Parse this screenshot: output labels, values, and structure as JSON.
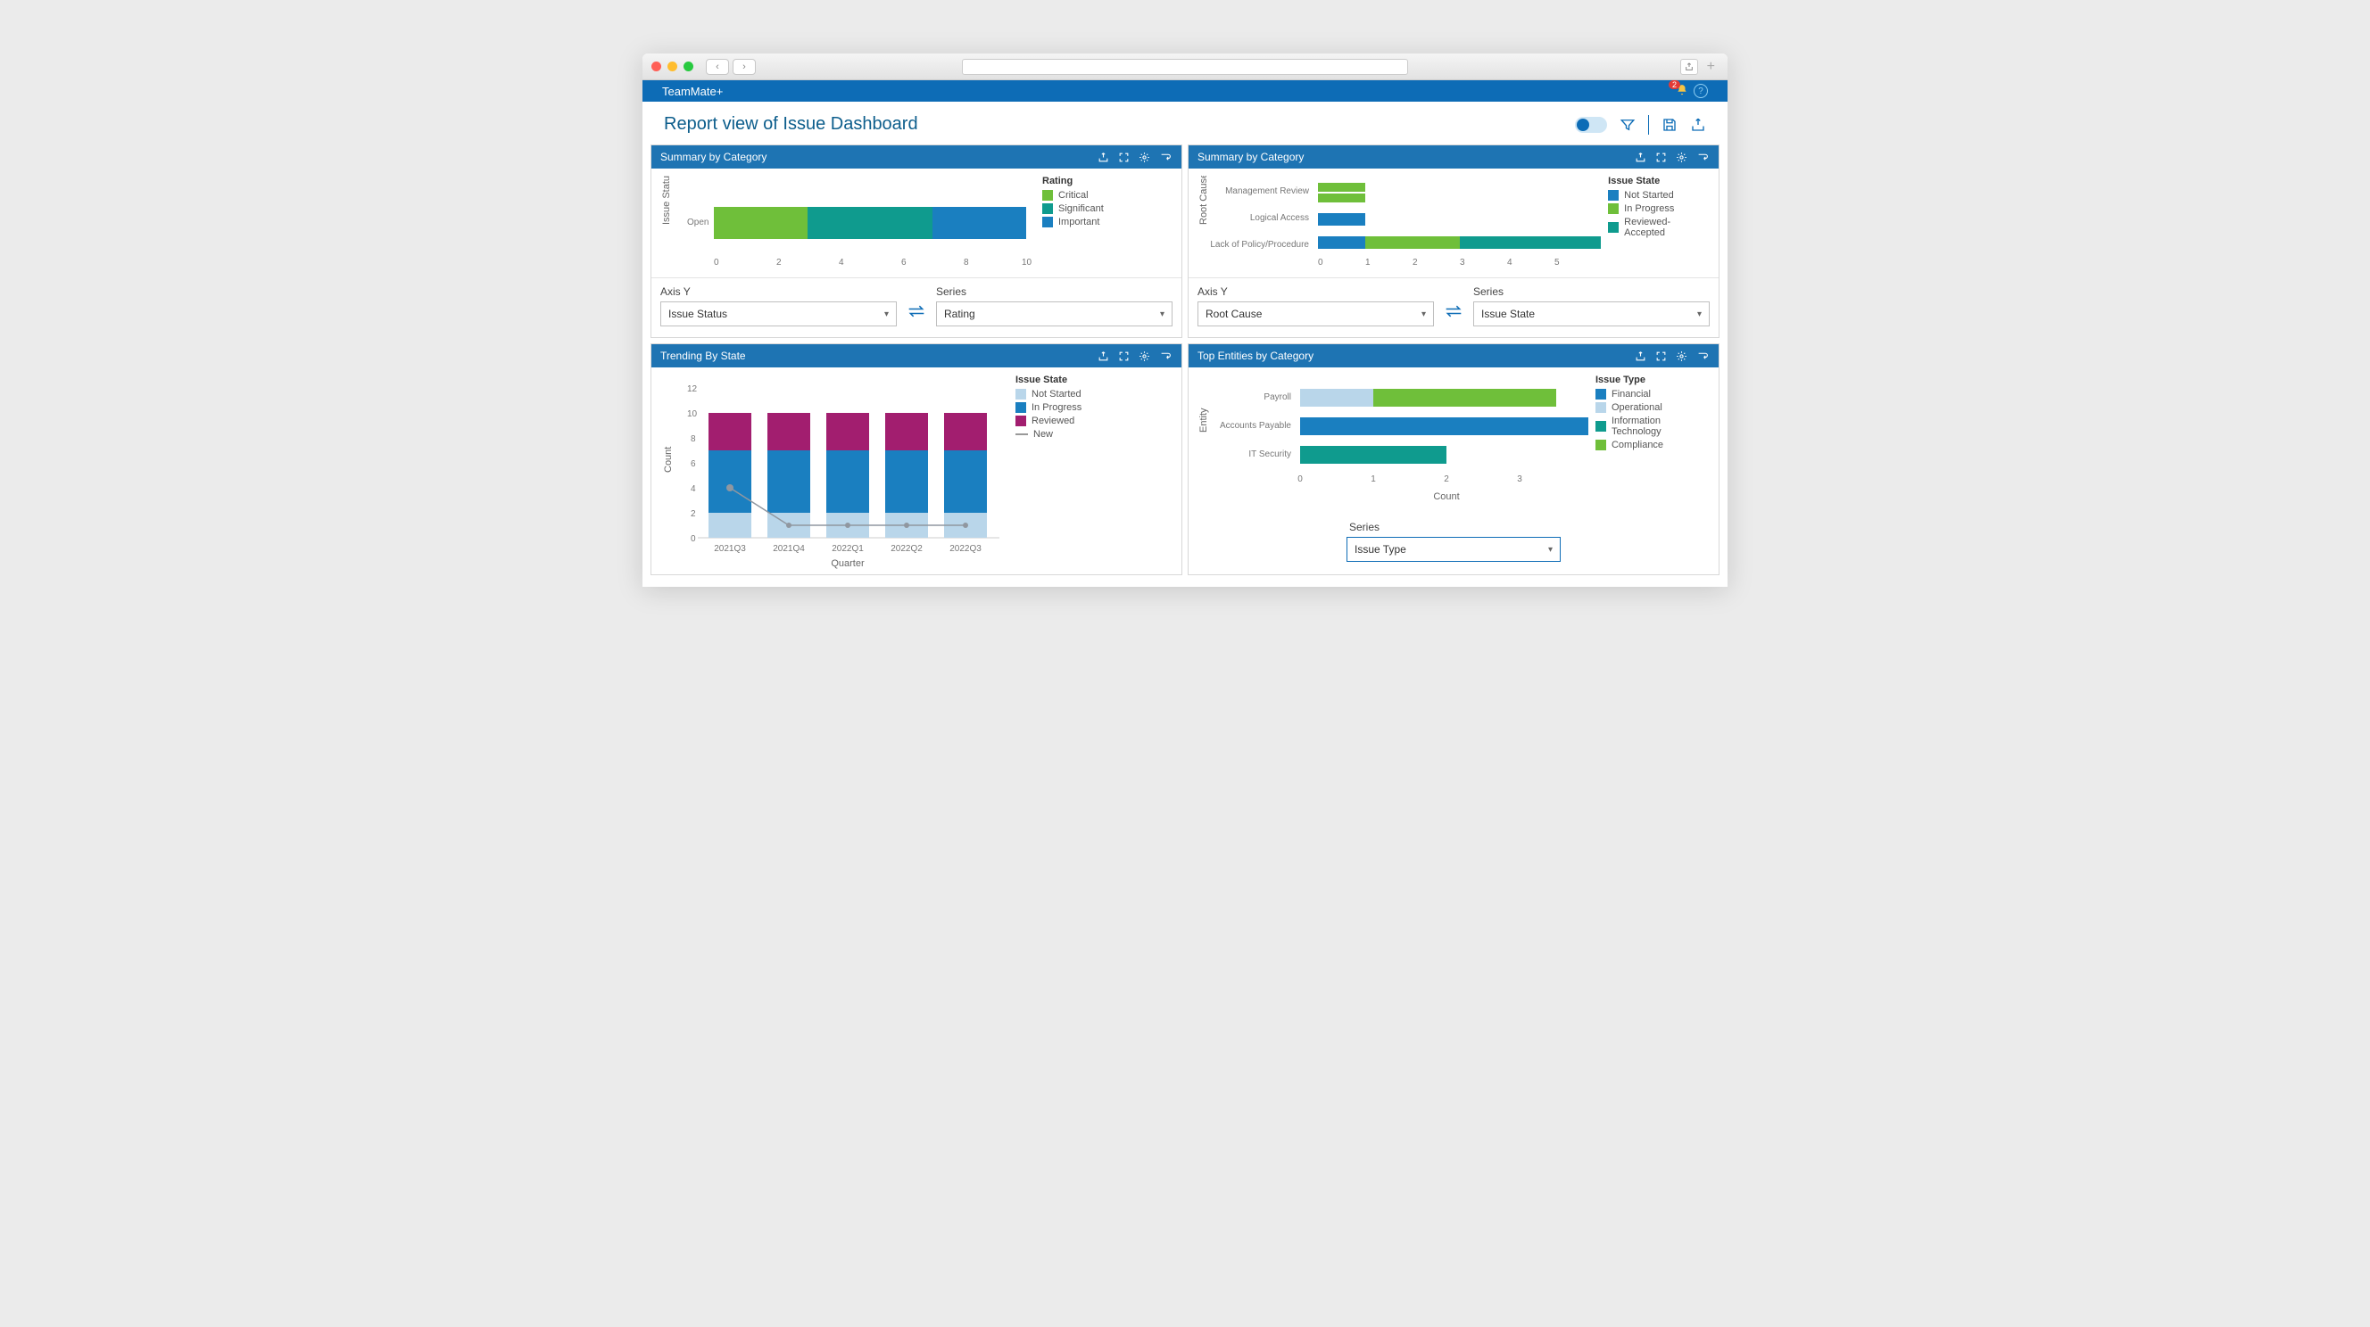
{
  "app": {
    "name": "TeamMate+",
    "notif_count": "2"
  },
  "page": {
    "title": "Report view of Issue Dashboard"
  },
  "panels": {
    "p1": {
      "title": "Summary by Category",
      "legend_title": "Rating",
      "legend": [
        "Critical",
        "Significant",
        "Important"
      ],
      "axisY_label": "Axis Y",
      "axisY_value": "Issue Status",
      "series_label": "Series",
      "series_value": "Rating",
      "y_axis_title": "Issue Status",
      "y_cat": "Open"
    },
    "p2": {
      "title": "Summary by Category",
      "legend_title": "Issue State",
      "legend": [
        "Not Started",
        "In Progress",
        "Reviewed-Accepted"
      ],
      "axisY_label": "Axis Y",
      "axisY_value": "Root Cause",
      "series_label": "Series",
      "series_value": "Issue State",
      "y_axis_title": "Root Cause",
      "y_cats": [
        "Management Review",
        "Logical Access",
        "Lack of Policy/Procedure"
      ]
    },
    "p3": {
      "title": "Trending By State",
      "legend_title": "Issue State",
      "legend": [
        "Not Started",
        "In Progress",
        "Reviewed",
        "New"
      ],
      "y_axis_title": "Count",
      "x_axis_title": "Quarter"
    },
    "p4": {
      "title": "Top Entities by Category",
      "legend_title": "Issue Type",
      "legend": [
        "Financial",
        "Operational",
        "Information Technology",
        "Compliance"
      ],
      "y_axis_title": "Entity",
      "x_axis_title": "Count",
      "y_cats": [
        "Payroll",
        "Accounts Payable",
        "IT Security"
      ],
      "series_label": "Series",
      "series_value": "Issue Type"
    }
  },
  "chart_data": [
    {
      "id": "summary_left",
      "type": "bar",
      "orientation": "horizontal-stacked",
      "y_axis": "Issue Status",
      "categories": [
        "Open"
      ],
      "series": [
        {
          "name": "Critical",
          "values": [
            3
          ],
          "color": "#6fbf3a"
        },
        {
          "name": "Significant",
          "values": [
            4
          ],
          "color": "#0f9b8e"
        },
        {
          "name": "Important",
          "values": [
            3
          ],
          "color": "#1a7fc0"
        }
      ],
      "xlim": [
        0,
        10
      ]
    },
    {
      "id": "summary_right",
      "type": "bar",
      "orientation": "horizontal-stacked",
      "y_axis": "Root Cause",
      "categories": [
        "Management Review",
        "Logical Access",
        "Lack of Policy/Procedure"
      ],
      "series": [
        {
          "name": "Not Started",
          "values": [
            0,
            1,
            1
          ],
          "color": "#1a7fc0"
        },
        {
          "name": "In Progress",
          "values": [
            1,
            0,
            2
          ],
          "color": "#6fbf3a"
        },
        {
          "name": "Reviewed-Accepted",
          "values": [
            0,
            0,
            3
          ],
          "color": "#0f9b8e"
        }
      ],
      "note_rows": [
        {
          "row": "Management Review",
          "bars": [
            {
              "name": "In Progress",
              "value": 1
            },
            {
              "name": "In Progress",
              "value": 1
            }
          ],
          "render": "two green bars ~1 each"
        }
      ],
      "xlim": [
        0,
        6
      ]
    },
    {
      "id": "trending_by_state",
      "type": "bar",
      "orientation": "vertical-stacked-with-line",
      "x_axis": "Quarter",
      "y_axis": "Count",
      "categories": [
        "2021Q3",
        "2021Q4",
        "2022Q1",
        "2022Q2",
        "2022Q3"
      ],
      "series": [
        {
          "name": "Not Started",
          "values": [
            2,
            2,
            2,
            2,
            2
          ],
          "color": "#b9d6ea"
        },
        {
          "name": "In Progress",
          "values": [
            5,
            5,
            5,
            5,
            5
          ],
          "color": "#1a7fc0"
        },
        {
          "name": "Reviewed",
          "values": [
            3,
            3,
            3,
            3,
            3
          ],
          "color": "#a21e6f"
        }
      ],
      "line_series": {
        "name": "New",
        "values": [
          4,
          1,
          1,
          1,
          1
        ],
        "color": "#9aa"
      },
      "ylim": [
        0,
        12
      ]
    },
    {
      "id": "top_entities",
      "type": "bar",
      "orientation": "horizontal-stacked",
      "y_axis": "Entity",
      "x_axis": "Count",
      "categories": [
        "Payroll",
        "Accounts Payable",
        "IT Security"
      ],
      "series": [
        {
          "name": "Financial",
          "values": [
            0,
            4,
            0
          ],
          "color": "#1a7fc0"
        },
        {
          "name": "Operational",
          "values": [
            1,
            0,
            0
          ],
          "color": "#b9d6ea"
        },
        {
          "name": "Information Technology",
          "values": [
            0,
            0,
            2
          ],
          "color": "#0f9b8e"
        },
        {
          "name": "Compliance",
          "values": [
            2.5,
            0,
            0
          ],
          "color": "#6fbf3a"
        }
      ],
      "xlim": [
        0,
        4
      ]
    }
  ]
}
